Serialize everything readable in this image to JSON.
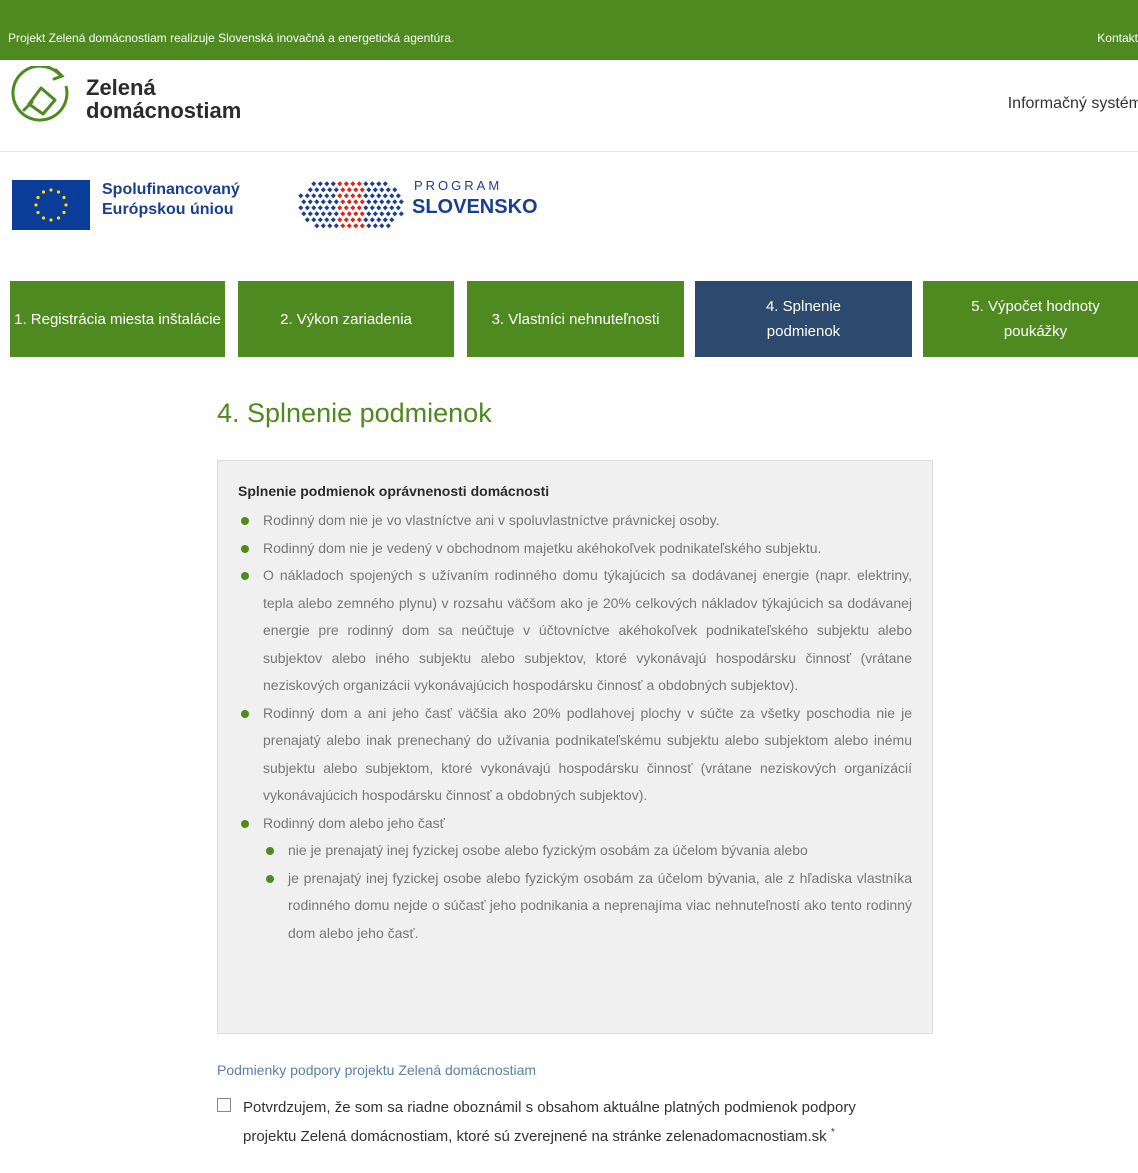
{
  "topbar": {
    "note": "Projekt Zelená domácnostiam realizuje Slovenská inovačná a energetická agentúra.",
    "contacts": "Kontakty"
  },
  "header": {
    "logo_line1": "Zelená",
    "logo_line2": "domácnostiam",
    "info_system": "Informačný systém"
  },
  "funding": {
    "eu_line1": "Spolufinancovaný",
    "eu_line2": "Európskou úniou",
    "program_top": "PROGRAM",
    "program_bottom": "SLOVENSKO"
  },
  "steps": [
    {
      "label": "1. Registrácia miesta inštalácie",
      "active": false
    },
    {
      "label": "2. Výkon zariadenia",
      "active": false
    },
    {
      "label": "3. Vlastníci nehnuteľnosti",
      "active": false
    },
    {
      "label": "4. Splnenie podmienok",
      "active": true
    },
    {
      "label": "5. Výpočet hodnoty poukážky",
      "active": false
    }
  ],
  "main": {
    "title": "4. Splnenie podmienok",
    "conditions": {
      "heading": "Splnenie podmienok oprávnenosti domácnosti",
      "items": [
        "Rodinný dom nie je vo vlastníctve ani v spoluvlastníctve právnickej osoby.",
        "Rodinný dom nie je vedený v obchodnom majetku akéhokoľvek podnikateľského subjektu.",
        "O nákladoch spojených s užívaním rodinného domu týkajúcich sa dodávanej energie (napr. elektriny, tepla alebo zemného plynu) v rozsahu väčšom ako je 20% celkových nákladov týkajúcich sa dodávanej energie pre rodinný dom sa neúčtuje v účtovníctve akéhokoľvek podnikateľského subjektu alebo subjektov alebo iného subjektu alebo subjektov, ktoré vykonávajú hospodársku činnosť (vrátane neziskových organizácii vykonávajúcich hospodársku činnosť a obdobných subjektov).",
        "Rodinný dom a ani jeho časť väčšia ako 20% podlahovej plochy v súčte za všetky poschodia nie je prenajatý alebo inak prenechaný do užívania podnikateľskému subjektu alebo subjektom alebo inému subjektu alebo subjektom, ktoré vykonávajú hospodársku činnosť (vrátane neziskových organizácií vykonávajúcich hospodársku činnosť a obdobných subjektov).",
        "Rodinný dom alebo jeho časť"
      ],
      "subitems": [
        "nie je prenajatý inej fyzickej osobe alebo fyzickým osobám za účelom bývania alebo",
        "je prenajatý inej fyzickej osobe alebo fyzickým osobám za účelom bývania, ale z hľadiska vlastníka rodinného domu nejde o súčasť jeho podnikania a neprenajíma viac nehnuteľností ako tento rodinný dom alebo jeho časť."
      ]
    },
    "support_link": "Podmienky podpory projektu Zelená domácnostiam",
    "confirm_text": "Potvrdzujem, že som sa riadne oboznámil s obsahom aktuálne platných podmienok podpory projektu Zelená domácnostiam, ktoré sú zverejnené na stránke zelenadomacnostiam.sk",
    "required_mark": "*",
    "confirm_checked": false
  },
  "colors": {
    "brand_green": "#4e8a1f",
    "active_step": "#2c4a6e",
    "eu_blue": "#0a3d99",
    "program_red": "#e2231a"
  }
}
